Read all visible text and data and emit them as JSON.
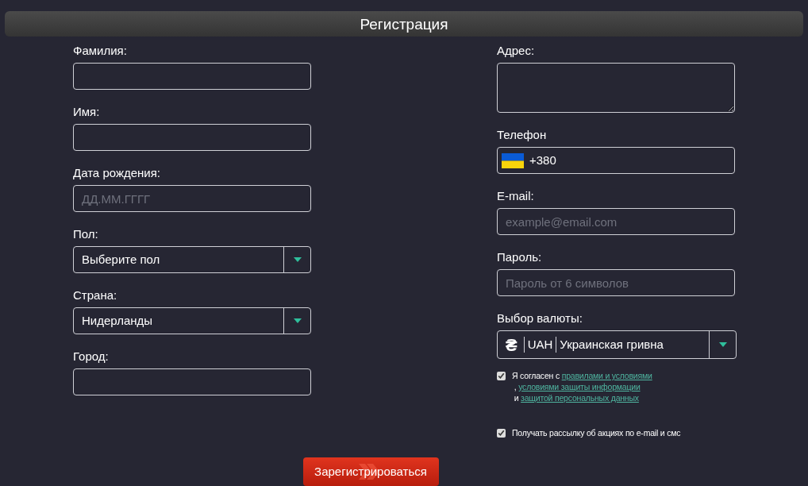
{
  "title": "Регистрация",
  "left_fields": [
    {
      "kind": "text",
      "label": "Фамилия:"
    },
    {
      "kind": "text",
      "label": "Имя:"
    },
    {
      "kind": "text",
      "label": "Дата рождения:",
      "placeholder": "ДД.ММ.ГГГГ"
    },
    {
      "kind": "select",
      "label": "Пол:",
      "value": "Выберите пол"
    },
    {
      "kind": "select",
      "label": "Страна:",
      "value": "Нидерланды"
    },
    {
      "kind": "text",
      "label": "Город:"
    }
  ],
  "right_fields": [
    {
      "kind": "textarea",
      "label": "Адрес:"
    },
    {
      "kind": "phone",
      "label": "Телефон",
      "value": "+380"
    },
    {
      "kind": "text",
      "label": "E-mail:",
      "placeholder": "example@email.com"
    },
    {
      "kind": "text",
      "label": "Пароль:",
      "placeholder": "Пароль от 6 символов"
    },
    {
      "kind": "currency",
      "label": "Выбор валюты:",
      "symbol": "₴",
      "code": "UAH",
      "value": "Украинская гривна"
    }
  ],
  "checkboxes": [
    {
      "checked": true,
      "parts": [
        {
          "kind": "text",
          "text": "Я согласен с "
        },
        {
          "kind": "link",
          "text": "правилами и условиями"
        },
        {
          "kind": "text",
          "text": " , "
        },
        {
          "kind": "link",
          "text": "условиями защиты информации"
        },
        {
          "kind": "text",
          "text": " и "
        },
        {
          "kind": "link",
          "text": "защитой персональных данных"
        }
      ]
    },
    {
      "checked": true,
      "parts": [
        {
          "kind": "text",
          "text": "Получать рассылку об акциях по e-mail и смс"
        }
      ]
    }
  ],
  "submit": "Зарегистрироваться"
}
